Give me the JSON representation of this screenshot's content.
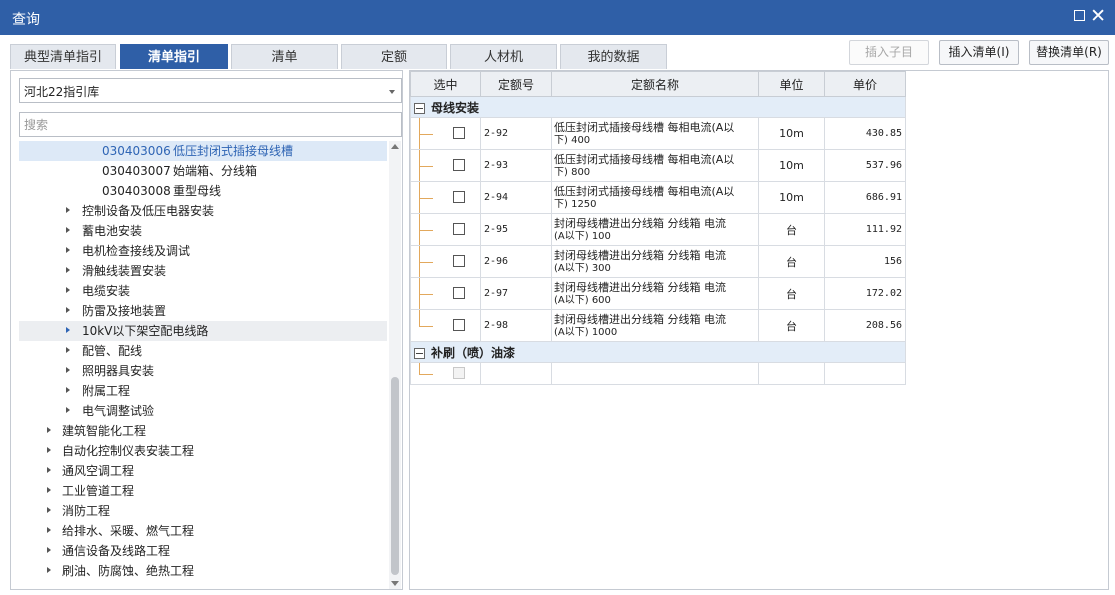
{
  "window": {
    "title": "查询"
  },
  "tabs": [
    {
      "label": "典型清单指引"
    },
    {
      "label": "清单指引"
    },
    {
      "label": "清单"
    },
    {
      "label": "定额"
    },
    {
      "label": "人材机"
    },
    {
      "label": "我的数据"
    }
  ],
  "actions": {
    "insert_child": "插入子目",
    "insert_list": "插入清单(I)",
    "replace_list": "替换清单(R)"
  },
  "left": {
    "library": "河北22指引库",
    "search_placeholder": "搜索",
    "tree": [
      {
        "code": "030403006",
        "name": "低压封闭式插接母线槽"
      },
      {
        "code": "030403007",
        "name": "始端箱、分线箱"
      },
      {
        "code": "030403008",
        "name": "重型母线"
      },
      {
        "label": "控制设备及低压电器安装"
      },
      {
        "label": "蓄电池安装"
      },
      {
        "label": "电机检查接线及调试"
      },
      {
        "label": "滑触线装置安装"
      },
      {
        "label": "电缆安装"
      },
      {
        "label": "防雷及接地装置"
      },
      {
        "label": "10kV以下架空配电线路"
      },
      {
        "label": "配管、配线"
      },
      {
        "label": "照明器具安装"
      },
      {
        "label": "附属工程"
      },
      {
        "label": "电气调整试验"
      },
      {
        "label": "建筑智能化工程"
      },
      {
        "label": "自动化控制仪表安装工程"
      },
      {
        "label": "通风空调工程"
      },
      {
        "label": "工业管道工程"
      },
      {
        "label": "消防工程"
      },
      {
        "label": "给排水、采暖、燃气工程"
      },
      {
        "label": "通信设备及线路工程"
      },
      {
        "label": "刷油、防腐蚀、绝热工程"
      }
    ]
  },
  "grid": {
    "columns": [
      "选中",
      "定额号",
      "定额名称",
      "单位",
      "单价"
    ],
    "groups": [
      {
        "name": "母线安装"
      },
      {
        "name": "补刷（喷）油漆"
      }
    ],
    "rows": [
      {
        "code": "2-92",
        "name1": "低压封闭式插接母线槽 每相电流(A以",
        "name2": "下) 400",
        "unit": "10m",
        "price": "430.85"
      },
      {
        "code": "2-93",
        "name1": "低压封闭式插接母线槽 每相电流(A以",
        "name2": "下) 800",
        "unit": "10m",
        "price": "537.96"
      },
      {
        "code": "2-94",
        "name1": "低压封闭式插接母线槽 每相电流(A以",
        "name2": "下) 1250",
        "unit": "10m",
        "price": "686.91"
      },
      {
        "code": "2-95",
        "name1": "封闭母线槽进出分线箱 分线箱 电流",
        "name2": "(A以下) 100",
        "unit": "台",
        "price": "111.92"
      },
      {
        "code": "2-96",
        "name1": "封闭母线槽进出分线箱 分线箱 电流",
        "name2": "(A以下) 300",
        "unit": "台",
        "price": "156"
      },
      {
        "code": "2-97",
        "name1": "封闭母线槽进出分线箱 分线箱 电流",
        "name2": "(A以下) 600",
        "unit": "台",
        "price": "172.02"
      },
      {
        "code": "2-98",
        "name1": "封闭母线槽进出分线箱 分线箱 电流",
        "name2": "(A以下) 1000",
        "unit": "台",
        "price": "208.56"
      }
    ]
  }
}
